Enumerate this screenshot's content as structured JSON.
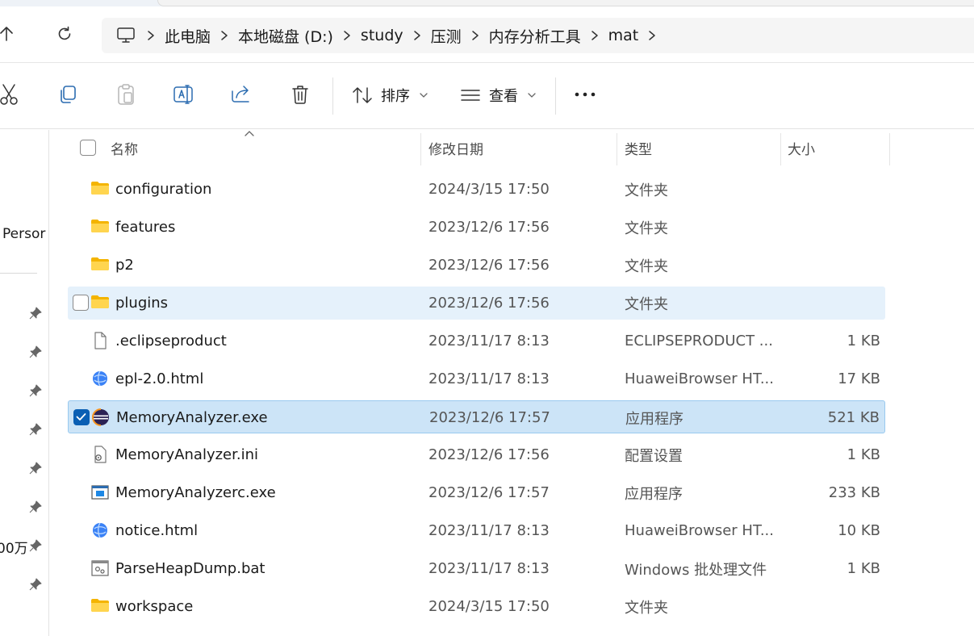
{
  "breadcrumb": {
    "items": [
      "此电脑",
      "本地磁盘 (D:)",
      "study",
      "压测",
      "内存分析工具",
      "mat"
    ]
  },
  "toolbar": {
    "sort_label": "排序",
    "view_label": "查看"
  },
  "sidebar": {
    "quick_access_label": "Persor",
    "partial_label": "00万"
  },
  "columns": {
    "name": "名称",
    "date": "修改日期",
    "type": "类型",
    "size": "大小"
  },
  "files": [
    {
      "name": "configuration",
      "date": "2024/3/15 17:50",
      "type": "文件夹",
      "size": "",
      "icon": "folder-icon"
    },
    {
      "name": "features",
      "date": "2023/12/6 17:56",
      "type": "文件夹",
      "size": "",
      "icon": "folder-icon"
    },
    {
      "name": "p2",
      "date": "2023/12/6 17:56",
      "type": "文件夹",
      "size": "",
      "icon": "folder-icon"
    },
    {
      "name": "plugins",
      "date": "2023/12/6 17:56",
      "type": "文件夹",
      "size": "",
      "icon": "folder-icon",
      "state": "hover"
    },
    {
      "name": ".eclipseproduct",
      "date": "2023/11/17 8:13",
      "type": "ECLIPSEPRODUCT ...",
      "size": "1 KB",
      "icon": "blank-file-icon"
    },
    {
      "name": "epl-2.0.html",
      "date": "2023/11/17 8:13",
      "type": "HuaweiBrowser HT...",
      "size": "17 KB",
      "icon": "browser-html-icon"
    },
    {
      "name": "MemoryAnalyzer.exe",
      "date": "2023/12/6 17:57",
      "type": "应用程序",
      "size": "521 KB",
      "icon": "eclipse-exe-icon",
      "state": "selected"
    },
    {
      "name": "MemoryAnalyzer.ini",
      "date": "2023/12/6 17:56",
      "type": "配置设置",
      "size": "1 KB",
      "icon": "settings-file-icon"
    },
    {
      "name": "MemoryAnalyzerc.exe",
      "date": "2023/12/6 17:57",
      "type": "应用程序",
      "size": "233 KB",
      "icon": "app-window-icon"
    },
    {
      "name": "notice.html",
      "date": "2023/11/17 8:13",
      "type": "HuaweiBrowser HT...",
      "size": "10 KB",
      "icon": "browser-html-icon"
    },
    {
      "name": "ParseHeapDump.bat",
      "date": "2023/11/17 8:13",
      "type": "Windows 批处理文件",
      "size": "1 KB",
      "icon": "batch-file-icon"
    },
    {
      "name": "workspace",
      "date": "2024/3/15 17:50",
      "type": "文件夹",
      "size": "",
      "icon": "folder-icon"
    }
  ],
  "colors": {
    "accent": "#0a5fb4",
    "selected_bg": "#cce4f7",
    "hover_bg": "#e5f1fb",
    "folder": "#ffca28"
  }
}
